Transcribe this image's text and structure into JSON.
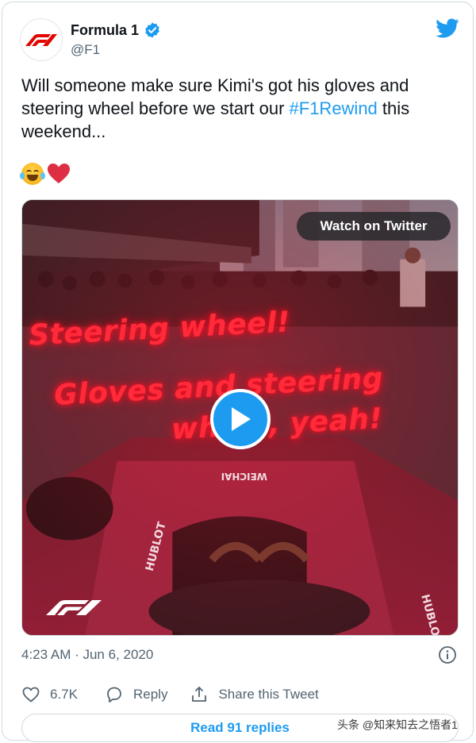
{
  "author": {
    "name": "Formula 1",
    "handle": "@F1",
    "verified": true
  },
  "tweet": {
    "text_before": "Will someone make sure Kimi's got his gloves and steering wheel before we start our ",
    "hashtag": "#F1Rewind",
    "text_after": " this weekend...",
    "emojis": [
      "face-with-tears-of-joy",
      "red-heart"
    ]
  },
  "media": {
    "watch_label": "Watch on Twitter",
    "overlay_line1": "Steering wheel!",
    "overlay_line2a": "Gloves and steering",
    "overlay_line2b": "wheel, yeah!",
    "car_text_1": "WEICHAI",
    "car_text_2": "HUBLOT",
    "car_text_3": "HUBLOT"
  },
  "meta": {
    "timestamp": "4:23 AM · Jun 6, 2020"
  },
  "actions": {
    "likes": "6.7K",
    "reply_label": "Reply",
    "share_label": "Share this Tweet"
  },
  "footer": {
    "read_replies": "Read 91 replies",
    "watermark": "头条 @知来知去之悟者1"
  },
  "colors": {
    "accent": "#1d9bf0",
    "text": "#0f1419",
    "muted": "#536471",
    "f1_red": "#e10600"
  }
}
